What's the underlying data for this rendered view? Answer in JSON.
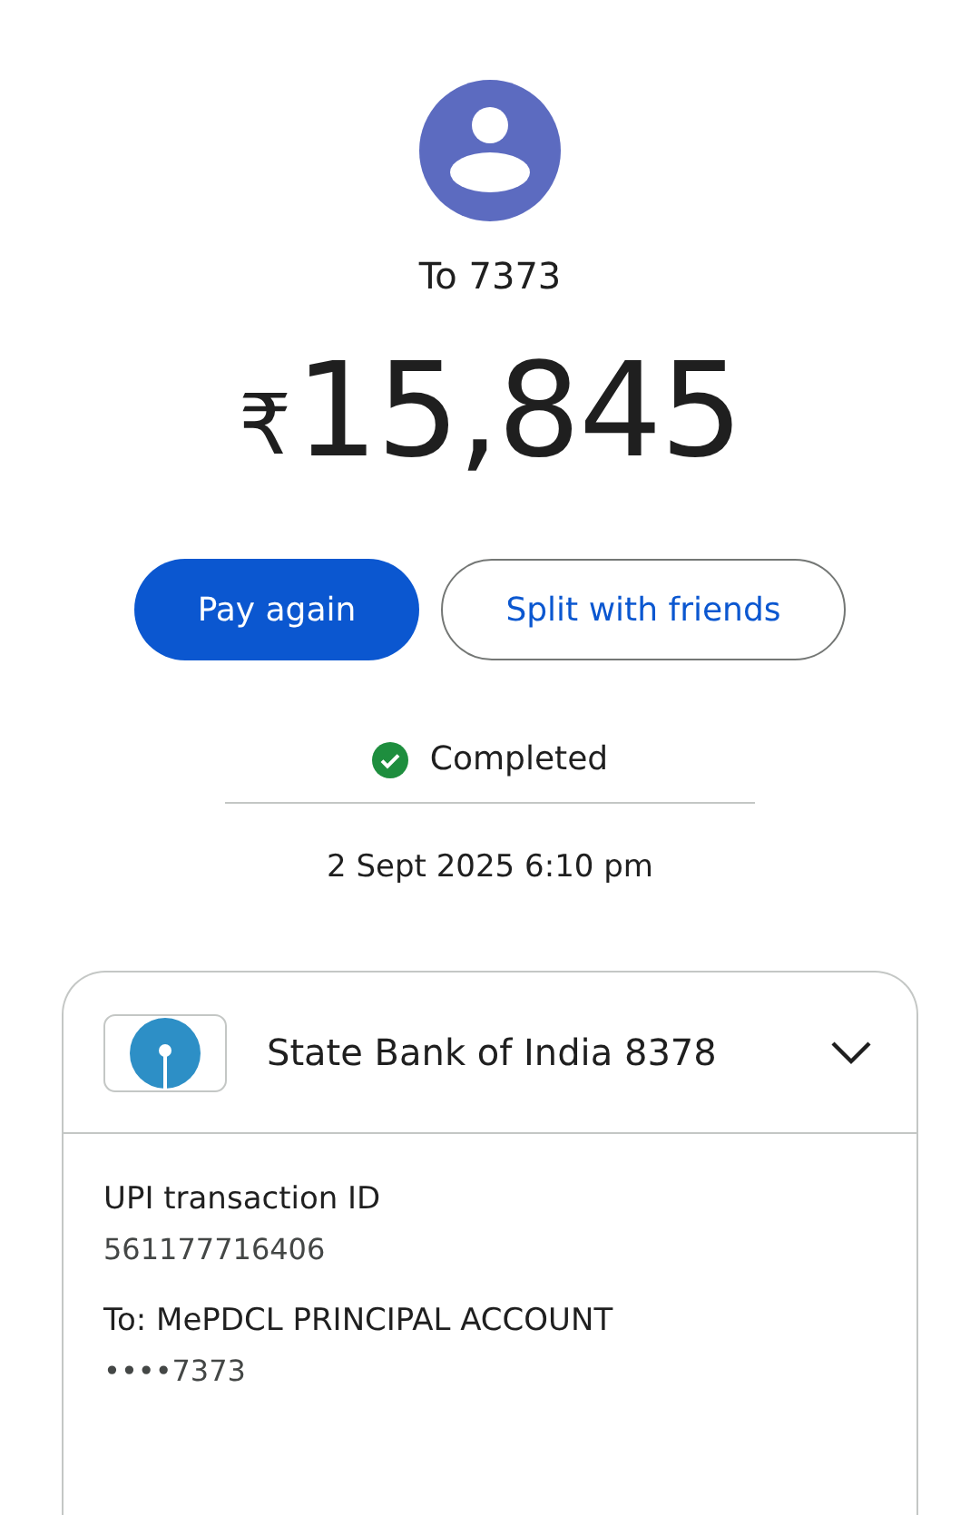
{
  "recipient": {
    "label": "To 7373"
  },
  "amount": {
    "currency": "₹",
    "value": "15,845"
  },
  "buttons": [
    {
      "label": "Pay again",
      "kind": "primary"
    },
    {
      "label": "Split with friends",
      "kind": "outline"
    }
  ],
  "status": {
    "label": "Completed"
  },
  "timestamp": "2 Sept 2025 6:10 pm",
  "account_card": {
    "bank": "State Bank of India 8378",
    "details": [
      {
        "label": "UPI transaction ID",
        "value": "561177716406"
      },
      {
        "label": "To: MePDCL PRINCIPAL ACCOUNT",
        "value": "••••7373"
      }
    ]
  }
}
